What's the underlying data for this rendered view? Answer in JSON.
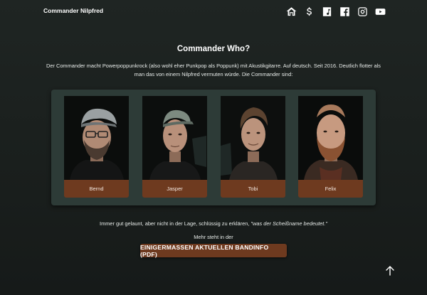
{
  "header": {
    "brand": "Commander Nilpfred",
    "nav_icons": [
      "home-icon",
      "dollar-icon",
      "music-note-icon",
      "facebook-icon",
      "instagram-icon",
      "youtube-icon"
    ]
  },
  "main": {
    "title": "Commander Who?",
    "intro_line1": "Der Commander macht Powerpoppunkrock (also wohl eher Punkpop als Poppunk) mit Akustikgitarre. Auf deutsch. Seit 2016. Deutlich flotter als",
    "intro_line2": "man das von einem Nilpfred vermuten würde. Die Commander sind:",
    "members": [
      {
        "name": "Bernd"
      },
      {
        "name": "Jasper"
      },
      {
        "name": "Tobi"
      },
      {
        "name": "Felix"
      }
    ],
    "tagline_prefix": "Immer gut gelaunt, aber nicht in der Lage, schlüssig zu erklären, ",
    "tagline_quote": "\"was der Scheißname bedeutet.\"",
    "more_text": "Mehr steht in der",
    "pdf_button": "EINIGERMASSEN AKTUELLEN BANDINFO (PDF)"
  },
  "colors": {
    "background": "#1c2220",
    "panel": "#2d3b37",
    "accent": "#6e3a1f",
    "text": "#ffffff"
  }
}
